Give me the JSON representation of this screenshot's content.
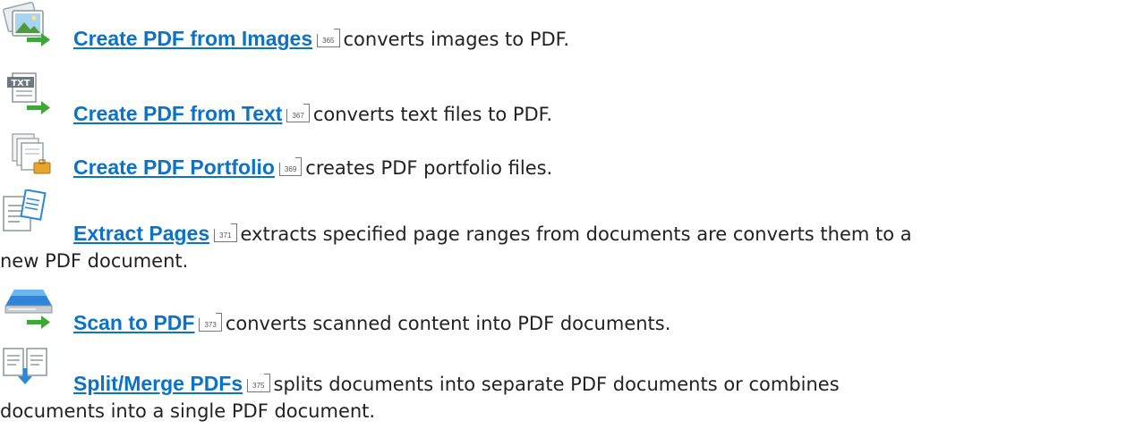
{
  "items": [
    {
      "link": "Create PDF from Images",
      "ref": "365",
      "desc": "converts images to PDF."
    },
    {
      "link": "Create PDF from Text",
      "ref": "367",
      "desc": "converts text files to PDF.",
      "icon_text": "TXT"
    },
    {
      "link": "Create PDF Portfolio",
      "ref": "369",
      "desc": "creates PDF portfolio files."
    },
    {
      "link": "Extract Pages",
      "ref": "371",
      "desc": "extracts specified page ranges from documents are converts them to a",
      "desc_cont": "new PDF document."
    },
    {
      "link": "Scan to PDF",
      "ref": "373",
      "desc": "converts scanned content into PDF documents."
    },
    {
      "link": "Split/Merge PDFs",
      "ref": "375",
      "desc": "splits documents into separate PDF documents or combines",
      "desc_cont": "documents into a single PDF document."
    }
  ],
  "colors": {
    "link": "#0a72c7",
    "arrow": "#3fa63a",
    "text": "#222222"
  }
}
